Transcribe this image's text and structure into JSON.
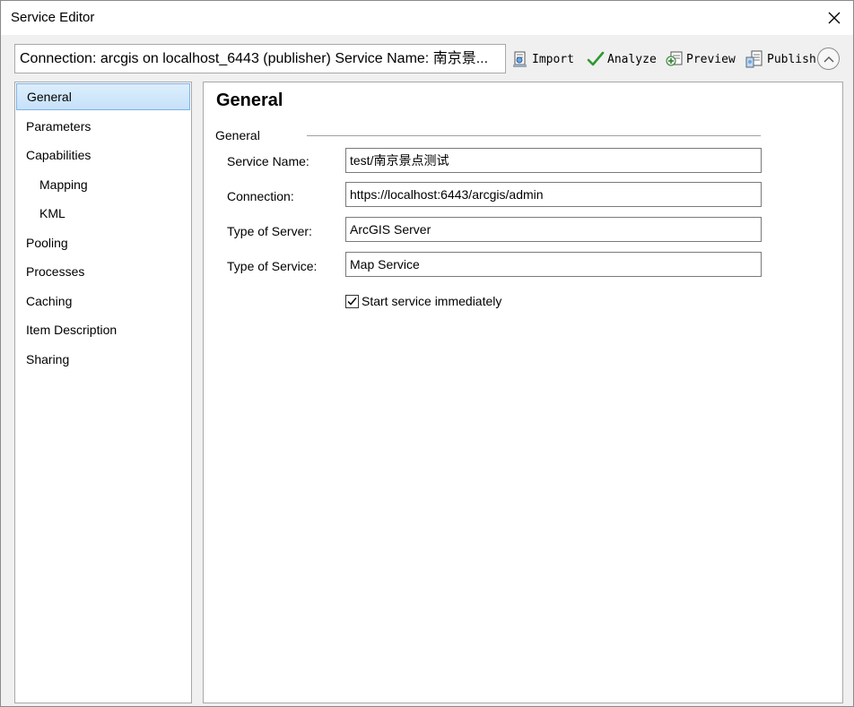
{
  "window": {
    "title": "Service Editor"
  },
  "toolbar": {
    "connection_text": "Connection: arcgis on localhost_6443 (publisher)   Service Name: 南京景...",
    "import_label": "Import",
    "analyze_label": "Analyze",
    "preview_label": "Preview",
    "publish_label": "Publish"
  },
  "sidebar": {
    "items": [
      {
        "label": "General"
      },
      {
        "label": "Parameters"
      },
      {
        "label": "Capabilities"
      },
      {
        "label": "Mapping"
      },
      {
        "label": "KML"
      },
      {
        "label": "Pooling"
      },
      {
        "label": "Processes"
      },
      {
        "label": "Caching"
      },
      {
        "label": "Item Description"
      },
      {
        "label": "Sharing"
      }
    ]
  },
  "main": {
    "title": "General",
    "group_label": "General",
    "fields": [
      {
        "label": "Service Name:",
        "value": "test/南京景点测试"
      },
      {
        "label": "Connection:",
        "value": "https://localhost:6443/arcgis/admin"
      },
      {
        "label": "Type of Server:",
        "value": "ArcGIS Server"
      },
      {
        "label": "Type of Service:",
        "value": "Map Service"
      }
    ],
    "start_immediately": {
      "label": "Start service immediately",
      "checked": true
    }
  },
  "colors": {
    "selection_bg": "#c6e1f9",
    "selection_border": "#7cb2e6",
    "analyze_check": "#2e9a2e"
  }
}
